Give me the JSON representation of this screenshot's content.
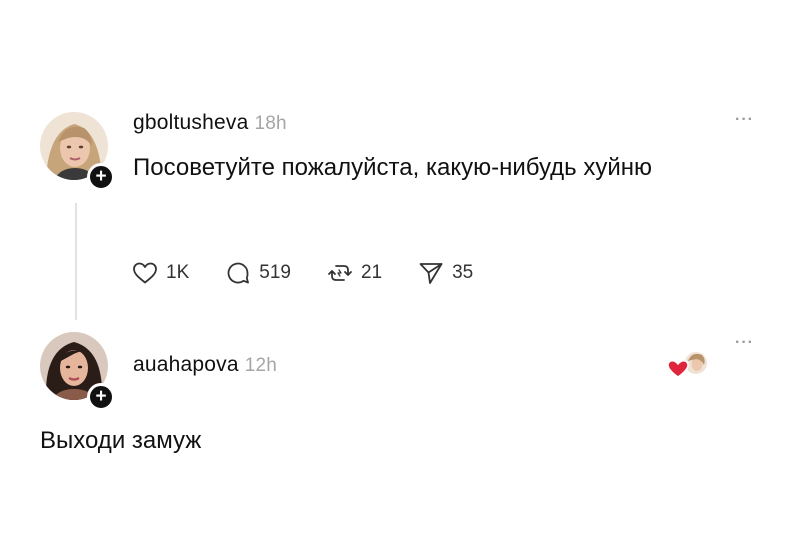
{
  "post": {
    "username": "gboltusheva",
    "time": "18h",
    "text": "Посоветуйте пожалуйста, какую-нибудь хуйню",
    "follow_symbol": "+",
    "more_symbol": "···",
    "actions": {
      "like_count": "1K",
      "reply_count": "519",
      "repost_count": "21",
      "share_count": "35"
    },
    "icons": [
      "heart-icon",
      "comment-icon",
      "repost-icon",
      "send-icon",
      "more-icon",
      "plus-icon"
    ]
  },
  "reply": {
    "username": "auahapova",
    "time": "12h",
    "text": "Выходи замуж",
    "follow_symbol": "+",
    "more_symbol": "···",
    "icons": [
      "author-liked-heart-icon",
      "more-icon",
      "plus-icon"
    ]
  },
  "colors": {
    "text": "#111111",
    "muted": "#a5a5a5",
    "liked_heart": "#e0243c",
    "thread_line": "#e2e2e2"
  }
}
